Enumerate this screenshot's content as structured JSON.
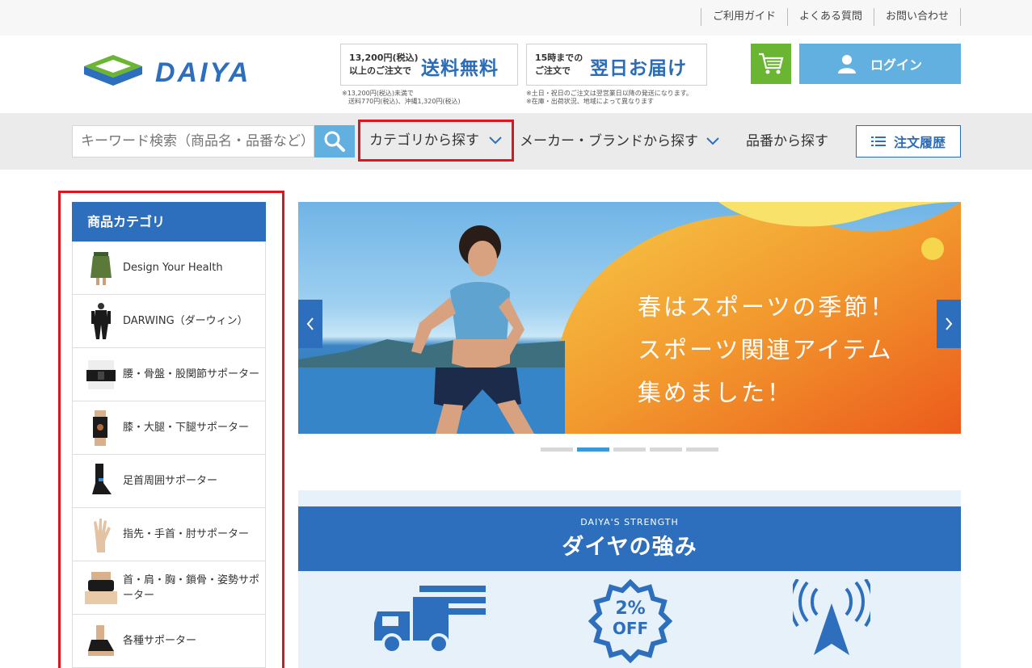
{
  "top_links": [
    "ご利用ガイド",
    "よくある質問",
    "お問い合わせ"
  ],
  "brand": {
    "logo_text": "DAIYA"
  },
  "promo": {
    "shipping_small_1": "13,200円(税込)",
    "shipping_small_2": "以上のご注文で",
    "shipping_big": "送料無料",
    "shipping_note_1": "※13,200円(税込)未満で",
    "shipping_note_2": "送料770円(税込)、沖縄1,320円(税込)",
    "delivery_small_1": "15時までの",
    "delivery_small_2": "ご注文で",
    "delivery_big": "翌日お届け",
    "delivery_note_1": "※土日・祝日のご注文は翌営業日以降の発送になります。",
    "delivery_note_2": "※在庫・出荷状況、地域によって異なります"
  },
  "header": {
    "login_label": "ログイン"
  },
  "nav": {
    "search_placeholder": "キーワード検索（商品名・品番など）",
    "category_label": "カテゴリから探す",
    "maker_label": "メーカー・ブランドから探す",
    "part_label": "品番から探す",
    "history_label": "注文履歴"
  },
  "sidebar": {
    "title": "商品カテゴリ",
    "items": [
      {
        "label": "Design Your Health",
        "icon": "green-skirt-icon"
      },
      {
        "label": "DARWING（ダーウィン）",
        "icon": "bodysuit-icon"
      },
      {
        "label": "腰・骨盤・股関節サポーター",
        "icon": "waist-belt-icon"
      },
      {
        "label": "膝・大腿・下腿サポーター",
        "icon": "knee-support-icon"
      },
      {
        "label": "足首周囲サポーター",
        "icon": "ankle-support-icon"
      },
      {
        "label": "指先・手首・肘サポーター",
        "icon": "hand-icon"
      },
      {
        "label": "首・肩・胸・鎖骨・姿勢サポーター",
        "icon": "neck-support-icon"
      },
      {
        "label": "各種サポーター",
        "icon": "foot-support-icon"
      }
    ]
  },
  "banner": {
    "line1": "春はスポーツの季節！",
    "line2": "スポーツ関連アイテム",
    "line3": "集めました！",
    "active_slide": 2,
    "slide_count": 5
  },
  "strength": {
    "subtitle": "DAIYA'S STRENGTH",
    "title": "ダイヤの強み",
    "badge_percent": "2%",
    "badge_off": "OFF"
  },
  "colors": {
    "brand_blue": "#2e6fbd",
    "light_blue": "#62b0e0",
    "cart_green": "#6ab531",
    "highlight_red": "#e0141e"
  }
}
